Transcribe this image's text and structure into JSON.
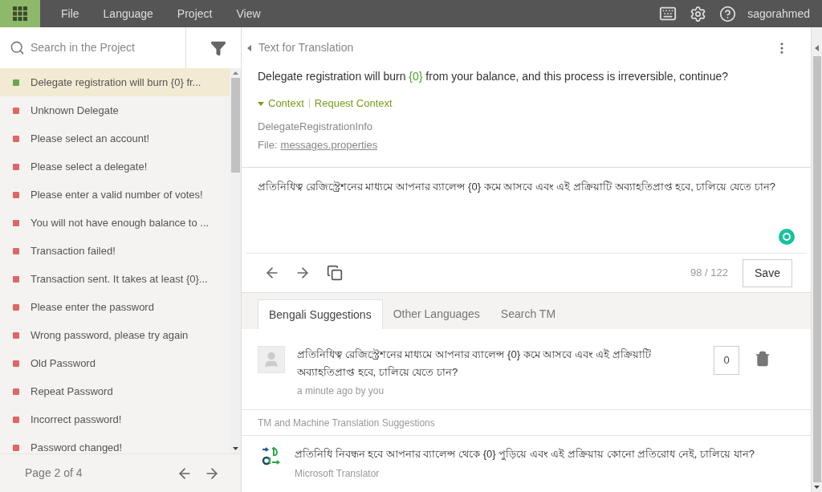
{
  "menu": [
    "File",
    "Language",
    "Project",
    "View"
  ],
  "user": "sagorahmed",
  "search": {
    "placeholder": "Search in the Project"
  },
  "strings": [
    {
      "text": "Delegate registration will burn {0} fr...",
      "selected": true,
      "color": "#6aa84f"
    },
    {
      "text": "Unknown Delegate",
      "selected": false,
      "color": "#e06666"
    },
    {
      "text": "Please select an account!",
      "selected": false,
      "color": "#e06666"
    },
    {
      "text": "Please select a delegate!",
      "selected": false,
      "color": "#e06666"
    },
    {
      "text": "Please enter a valid number of votes!",
      "selected": false,
      "color": "#e06666"
    },
    {
      "text": "You will not have enough balance to ...",
      "selected": false,
      "color": "#e06666"
    },
    {
      "text": "Transaction failed!",
      "selected": false,
      "color": "#e06666"
    },
    {
      "text": "Transaction sent. It takes at least {0}...",
      "selected": false,
      "color": "#e06666"
    },
    {
      "text": "Please enter the password",
      "selected": false,
      "color": "#e06666"
    },
    {
      "text": "Wrong password, please try again",
      "selected": false,
      "color": "#e06666"
    },
    {
      "text": "Old Password",
      "selected": false,
      "color": "#e06666"
    },
    {
      "text": "Repeat Password",
      "selected": false,
      "color": "#e06666"
    },
    {
      "text": "Incorrect password!",
      "selected": false,
      "color": "#e06666"
    },
    {
      "text": "Password changed!",
      "selected": false,
      "color": "#e06666"
    }
  ],
  "pagination": "Page 2 of 4",
  "source": {
    "heading": "Text for Translation",
    "before": "Delegate registration will burn ",
    "placeholder": "{0}",
    "after": " from your balance, and this process is irreversible, continue?",
    "context_toggle": "Context",
    "context_expanded": true,
    "request_context": "Request Context",
    "key": "DelegateRegistrationInfo",
    "file_label": "File:",
    "file": "messages.properties"
  },
  "translation": {
    "value": "প্রতিনিধিত্ব রেজিস্ট্রেশনের মাধ্যমে আপনার ব্যালেন্স {0} কমে আসবে এবং এই প্রক্রিয়াটি অব্যাহতিপ্রাপ্ত হবে, চালিয়ে যেতে চান?",
    "count": "98 / 122",
    "save": "Save"
  },
  "tabs": [
    {
      "label": "Bengali Suggestions",
      "selected": true
    },
    {
      "label": "Other Languages",
      "selected": false
    },
    {
      "label": "Search TM",
      "selected": false
    }
  ],
  "suggestion": {
    "text": "প্রতিনিধিত্ব রেজিস্ট্রেশনের মাধ্যমে আপনার ব্যালেন্স {0} কমে আসবে এবং এই প্রক্রিয়াটি অব্যাহতিপ্রাপ্ত হবে, চালিয়ে যেতে চান?",
    "meta": "a minute ago by you",
    "votes": "0"
  },
  "tm_heading": "TM and Machine Translation Suggestions",
  "machine": {
    "text": "প্রতিনিধি নিবন্ধন হবে আপনার ব্যালেন্স থেকে {0} পুড়িয়ে এবং এই প্রক্রিয়ায় কোনো প্রতিরোধ নেই, চালিয়ে যান?",
    "source": "Microsoft Translator"
  }
}
